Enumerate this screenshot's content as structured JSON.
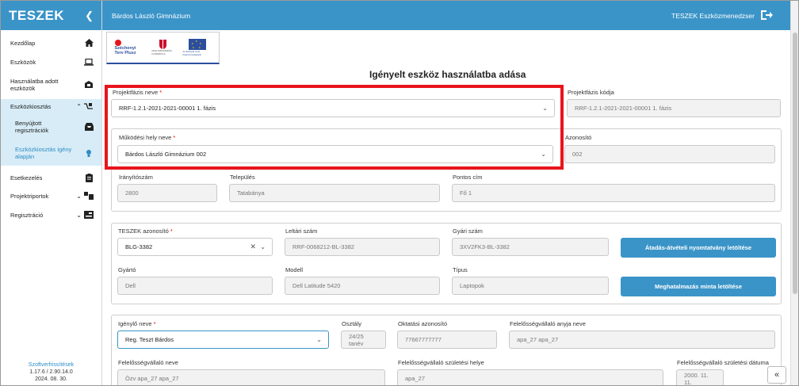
{
  "sidebar": {
    "brand": "TESZEK",
    "items": [
      {
        "label": "Kezdőlap",
        "icon": "home-icon"
      },
      {
        "label": "Eszközök",
        "icon": "laptop-icon"
      },
      {
        "label": "Használatba adott eszközök",
        "icon": "handover-icon"
      },
      {
        "label": "Eszközkiosztás",
        "icon": "distribution-icon"
      },
      {
        "label": "Benyújtott regisztrációk",
        "icon": "inbox-icon"
      },
      {
        "label": "Eszközkiosztás igény alapján",
        "icon": "request-icon"
      },
      {
        "label": "Esetkezelés",
        "icon": "clipboard-icon"
      },
      {
        "label": "Projektriportok",
        "icon": "report-icon"
      },
      {
        "label": "Regisztráció",
        "icon": "registration-icon"
      }
    ],
    "footer": {
      "link": "Szoftverfrissítések",
      "version": "1.17.6 / 2.90.14.0",
      "date": "2024. 08. 30."
    }
  },
  "topbar": {
    "school": "Bárdos László Gimnázium",
    "app": "TESZEK Eszközmenedzser"
  },
  "banner": {
    "szechenyi": "Széchenyi Terv Plusz",
    "ministry": "MAGYARORSZÁG KORMÁNYA",
    "eu": "Az Európai Unió finanszírozásával"
  },
  "page": {
    "title": "Igényelt eszköz használatba adása"
  },
  "form": {
    "projektfazis_label": "Projektfázis neve",
    "projektfazis_value": "RRF-1.2.1-2021-2021-00001 1. fázis",
    "projektfazis_kod_label": "Projektfázis kódja",
    "projektfazis_kod_value": "RRF-1.2.1-2021-2021-00001 1. fázis",
    "mukodesi_label": "Működési hely neve",
    "mukodesi_value": "Bárdos László Gimnázium 002",
    "azonosito_label": "Azonosító",
    "azonosito_value": "002",
    "irsz_label": "Irányítószám",
    "irsz_value": "2800",
    "telepules_label": "Település",
    "telepules_value": "Tatabánya",
    "cim_label": "Pontos cím",
    "cim_value": "Fő 1",
    "teszek_label": "TESZEK azonosító",
    "teszek_value": "BLG-3382",
    "leltari_label": "Leltári szám",
    "leltari_value": "RRF-0068212-BL-3382",
    "gyari_label": "Gyári szám",
    "gyari_value": "3XV2FK3-BL-3382",
    "btn_atadas": "Átadás-átvételi nyomtatvány letöltése",
    "gyarto_label": "Gyártó",
    "gyarto_value": "Dell",
    "modell_label": "Modell",
    "modell_value": "Dell Latitude 5420",
    "tipus_label": "Típus",
    "tipus_value": "Laptopok",
    "btn_meghatalmazas": "Meghatalmazás minta letöltése",
    "igenylo_label": "Igénylő neve",
    "igenylo_value": "Reg. Teszt Bárdos",
    "osztaly_label": "Osztály",
    "osztaly_value": "24/25 tanév",
    "oktatasi_label": "Oktatási azonosító",
    "oktatasi_value": "77667777777",
    "anyja_label": "Felelősségvállaló anyja neve",
    "anyja_value": "apa_27 apa_27",
    "fel_nev_label": "Felelősségvállaló neve",
    "fel_nev_value": "Özv apa_27 apa_27",
    "szul_hely_label": "Felelősségvállaló születési helye",
    "szul_hely_value": "apa_27",
    "szul_datum_label": "Felelősségvállaló születési dátuma",
    "szul_datum_value": "2000. 11. 11."
  },
  "colors": {
    "accent": "#3a94c8",
    "highlight": "#e8141c",
    "active_bg": "#d7ecf7"
  }
}
